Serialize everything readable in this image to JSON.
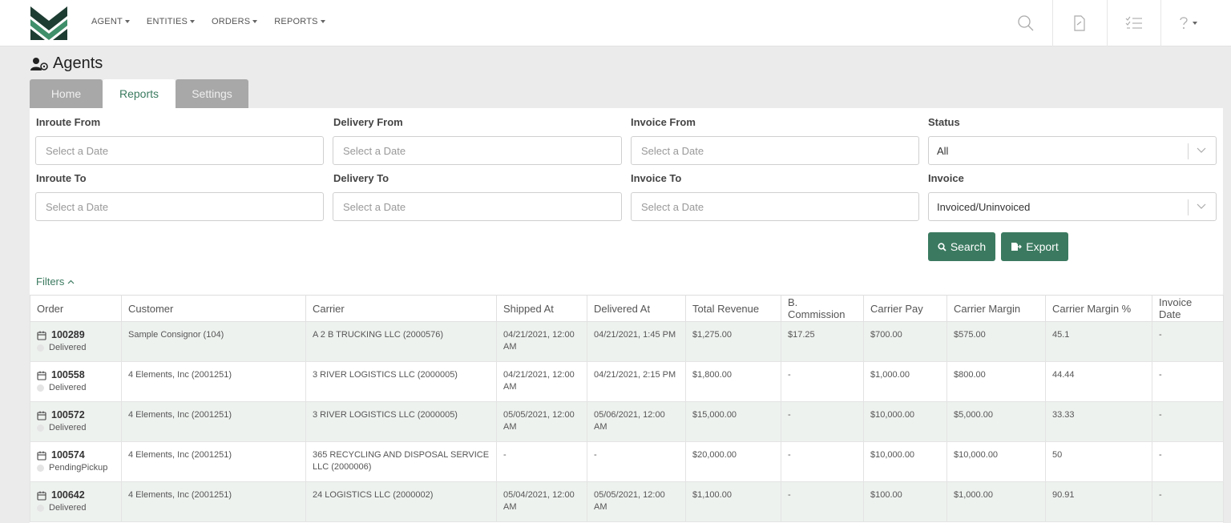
{
  "nav": {
    "items": [
      {
        "label": "AGENT"
      },
      {
        "label": "ENTITIES"
      },
      {
        "label": "ORDERS"
      },
      {
        "label": "REPORTS"
      }
    ],
    "icons": [
      "search-icon",
      "document-icon",
      "checklist-icon",
      "help-icon"
    ]
  },
  "page": {
    "title": "Agents",
    "icon": "agents-icon"
  },
  "tabs": [
    {
      "label": "Home"
    },
    {
      "label": "Reports"
    },
    {
      "label": "Settings"
    }
  ],
  "filters": {
    "inroute_from": {
      "label": "Inroute From",
      "placeholder": "Select a Date"
    },
    "delivery_from": {
      "label": "Delivery From",
      "placeholder": "Select a Date"
    },
    "invoice_from": {
      "label": "Invoice From",
      "placeholder": "Select a Date"
    },
    "status": {
      "label": "Status",
      "value": "All"
    },
    "inroute_to": {
      "label": "Inroute To",
      "placeholder": "Select a Date"
    },
    "delivery_to": {
      "label": "Delivery To",
      "placeholder": "Select a Date"
    },
    "invoice_to": {
      "label": "Invoice To",
      "placeholder": "Select a Date"
    },
    "invoice": {
      "label": "Invoice",
      "value": "Invoiced/Uninvoiced"
    },
    "search_label": "Search",
    "export_label": "Export",
    "toggle_label": "Filters"
  },
  "table": {
    "headers": [
      "Order",
      "Customer",
      "Carrier",
      "Shipped At",
      "Delivered At",
      "Total Revenue",
      "B. Commission",
      "Carrier Pay",
      "Carrier Margin",
      "Carrier Margin %",
      "Invoice Date"
    ],
    "rows": [
      {
        "order": "100289",
        "status": "Delivered",
        "customer": "Sample Consignor (104)",
        "carrier": "A 2 B TRUCKING LLC (2000576)",
        "shipped": "04/21/2021, 12:00 AM",
        "delivered": "04/21/2021, 1:45 PM",
        "revenue": "$1,275.00",
        "commission": "$17.25",
        "carrier_pay": "$700.00",
        "margin": "$575.00",
        "margin_pct": "45.1",
        "invoice_date": "-"
      },
      {
        "order": "100558",
        "status": "Delivered",
        "customer": "4 Elements, Inc (2001251)",
        "carrier": "3 RIVER LOGISTICS LLC (2000005)",
        "shipped": "04/21/2021, 12:00 AM",
        "delivered": "04/21/2021, 2:15 PM",
        "revenue": "$1,800.00",
        "commission": "-",
        "carrier_pay": "$1,000.00",
        "margin": "$800.00",
        "margin_pct": "44.44",
        "invoice_date": "-"
      },
      {
        "order": "100572",
        "status": "Delivered",
        "customer": "4 Elements, Inc (2001251)",
        "carrier": "3 RIVER LOGISTICS LLC (2000005)",
        "shipped": "05/05/2021, 12:00 AM",
        "delivered": "05/06/2021, 12:00 AM",
        "revenue": "$15,000.00",
        "commission": "-",
        "carrier_pay": "$10,000.00",
        "margin": "$5,000.00",
        "margin_pct": "33.33",
        "invoice_date": "-"
      },
      {
        "order": "100574",
        "status": "PendingPickup",
        "customer": "4 Elements, Inc (2001251)",
        "carrier": "365 RECYCLING AND DISPOSAL SERVICE LLC (2000006)",
        "shipped": "-",
        "delivered": "-",
        "revenue": "$20,000.00",
        "commission": "-",
        "carrier_pay": "$10,000.00",
        "margin": "$10,000.00",
        "margin_pct": "50",
        "invoice_date": "-"
      },
      {
        "order": "100642",
        "status": "Delivered",
        "customer": "4 Elements, Inc (2001251)",
        "carrier": "24 LOGISTICS LLC (2000002)",
        "shipped": "05/04/2021, 12:00 AM",
        "delivered": "05/05/2021, 12:00 AM",
        "revenue": "$1,100.00",
        "commission": "-",
        "carrier_pay": "$100.00",
        "margin": "$1,000.00",
        "margin_pct": "90.91",
        "invoice_date": "-"
      }
    ]
  },
  "colors": {
    "accent": "#3b7a60",
    "tab_inactive": "#a8a8a8",
    "row_striped": "#eef2ef",
    "logo_dark": "#1e3d32",
    "logo_light": "#3f8f6a"
  }
}
